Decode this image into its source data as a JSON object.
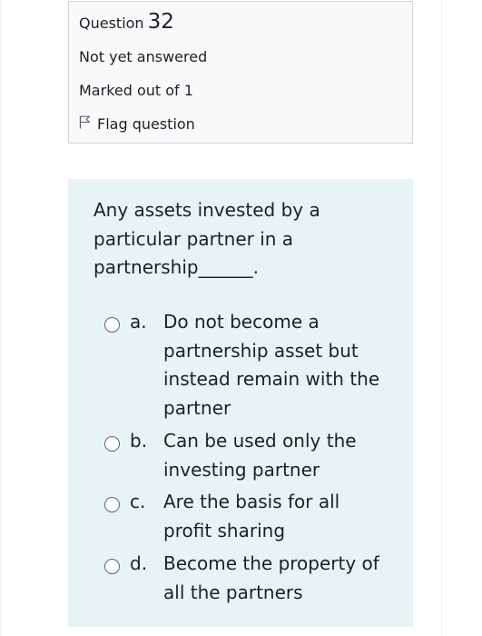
{
  "info": {
    "question_label": "Question",
    "question_number": "32",
    "state": "Not yet answered",
    "grade": "Marked out of 1",
    "flag_label": "Flag question",
    "flag_icon": "flag-outline-icon"
  },
  "question": {
    "text": "Any assets invested by a particular partner in a partnership______.",
    "answers": [
      {
        "letter": "a.",
        "text": "Do not become a partnership asset but instead remain with the partner"
      },
      {
        "letter": "b.",
        "text": "Can be used only the investing partner"
      },
      {
        "letter": "c.",
        "text": "Are the basis for all profit sharing"
      },
      {
        "letter": "d.",
        "text": "Become the property of all the partners"
      }
    ]
  },
  "colors": {
    "info_bg": "#f8f9fa",
    "info_border": "#cfd2d6",
    "question_bg": "#e7f3f5",
    "text": "#1d2125"
  }
}
